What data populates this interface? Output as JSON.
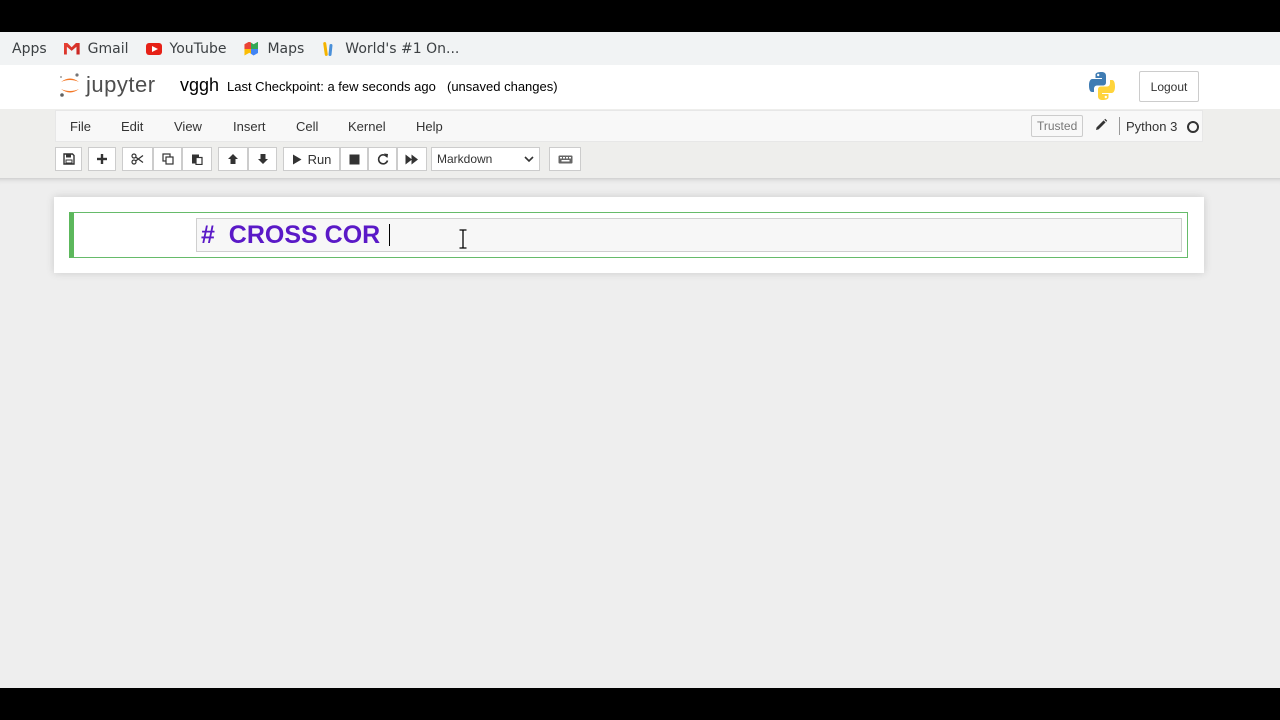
{
  "bookmarks": [
    {
      "label": "Apps",
      "icon": "apps-icon"
    },
    {
      "label": "Gmail",
      "icon": "gmail-icon"
    },
    {
      "label": "YouTube",
      "icon": "youtube-icon"
    },
    {
      "label": "Maps",
      "icon": "maps-icon"
    },
    {
      "label": "World's #1 On...",
      "icon": "bookmark-favicon-icon"
    }
  ],
  "header": {
    "logo_text": "jupyter",
    "notebook_name": "vggh",
    "checkpoint": "Last Checkpoint: a few seconds ago",
    "unsaved": "(unsaved changes)",
    "logout": "Logout"
  },
  "menu": {
    "items": [
      "File",
      "Edit",
      "View",
      "Insert",
      "Cell",
      "Kernel",
      "Help"
    ],
    "trusted": "Trusted",
    "kernel_name": "Python 3"
  },
  "toolbar": {
    "run_label": "Run",
    "cell_type": "Markdown"
  },
  "cell": {
    "source": "#  CROSS COR",
    "mode": "edit"
  },
  "colors": {
    "markdown_heading": "#5a19c7",
    "cell_border": "#5cb85c",
    "jupyter_orange": "#f37726"
  }
}
